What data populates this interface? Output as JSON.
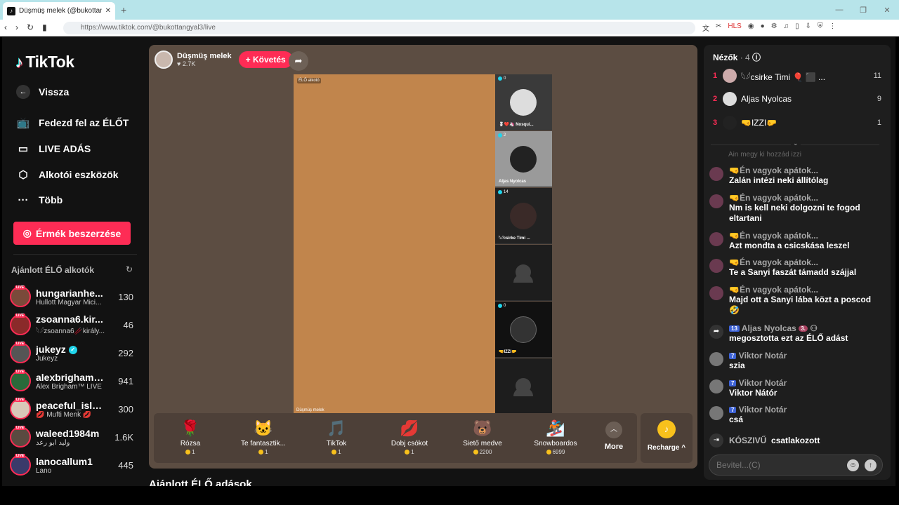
{
  "browser": {
    "tab_title": "Düşmüş melek (@bukottangy...",
    "tab_close": "✕",
    "new_tab": "+",
    "url": "https://www.tiktok.com/@bukottangyal3/live"
  },
  "sidebar": {
    "logo": "TikTok",
    "back": "Vissza",
    "items": [
      {
        "label": "Fedezd fel az ÉLŐT",
        "icon": "tv-icon"
      },
      {
        "label": "LIVE ADÁS",
        "icon": "camera-icon"
      },
      {
        "label": "Alkotói eszközök",
        "icon": "creator-tools-icon"
      },
      {
        "label": "Több",
        "icon": "more-dots-icon"
      }
    ],
    "coins_button": "Érmék beszerzése",
    "suggested_title": "Ajánlott ÉLŐ alkotók",
    "creators": [
      {
        "name": "hungarianhe...",
        "sub": "Hullott Magyar Mici...",
        "count": "130"
      },
      {
        "name": "zsoanna6.kir...",
        "sub": "𓆩𓆪zsoanna6🥢király...",
        "count": "46"
      },
      {
        "name": "jukeyz",
        "sub": "Jukeyz",
        "count": "292",
        "verified": true
      },
      {
        "name": "alexbrighaml...",
        "sub": "Alex Brigham™ LIVE",
        "count": "941"
      },
      {
        "name": "peaceful_isla...",
        "sub": "💋 Mufti Menk 💋",
        "count": "300"
      },
      {
        "name": "waleed1984m",
        "sub": "وليد ابو رعد",
        "count": "1.6K"
      },
      {
        "name": "lanocallum1",
        "sub": "Lano",
        "count": "445"
      }
    ],
    "live_badge": "LIVE"
  },
  "stream": {
    "host_name": "Düşmüş melek",
    "host_likes": "♥ 2.7K",
    "follow": "+ Követés",
    "video_tag": "ÉLŐ alkotó",
    "video_name": "Düşmüş melek",
    "guests": [
      {
        "count": "0",
        "name": "🎖❤️🦄 Nosqui..."
      },
      {
        "count": "2",
        "name": "Aljas Nyolcas"
      },
      {
        "count": "14",
        "name": "𓆩𓆪csirke Timi ..."
      },
      {
        "count": "",
        "name": ""
      },
      {
        "count": "0",
        "name": "🤜IZZI🤛"
      },
      {
        "count": "",
        "name": ""
      }
    ],
    "gifts": [
      {
        "name": "Rózsa",
        "price": "1",
        "icon": "🌹"
      },
      {
        "name": "Te fantasztik...",
        "price": "1",
        "icon": "🐱"
      },
      {
        "name": "TikTok",
        "price": "1",
        "icon": "🎵"
      },
      {
        "name": "Dobj csókot",
        "price": "1",
        "icon": "💋"
      },
      {
        "name": "Siető medve",
        "price": "2200",
        "icon": "🐻"
      },
      {
        "name": "Snowboardos",
        "price": "6999",
        "icon": "🏂"
      }
    ],
    "more": "More",
    "recharge": "Recharge ^",
    "recommended_title": "Ajánlott ÉLŐ adások"
  },
  "viewers": {
    "title": "Nézők",
    "count": "· 4",
    "list": [
      {
        "rank": "1",
        "name": "𓆩𓆪csirke Timi 🎈 ⬛ ...",
        "score": "11"
      },
      {
        "rank": "2",
        "name": "Aljas Nyolcas",
        "score": "9"
      },
      {
        "rank": "3",
        "name": "🤜IZZI🤛",
        "score": "1"
      }
    ]
  },
  "chat": {
    "faded": "Ain megy ki hozzád izzi",
    "messages": [
      {
        "name": "🤜Én vagyok apátok...",
        "text": "Zalán intézi neki állítólag"
      },
      {
        "name": "🤜Én vagyok apátok...",
        "text": "Nm is kell neki dolgozni te fogod eltartani"
      },
      {
        "name": "🤜Én vagyok apátok...",
        "text": "Azt mondta a csicskása leszel"
      },
      {
        "name": "🤜Én vagyok apátok...",
        "text": "Te a Sanyi faszát támadd szájjal"
      },
      {
        "name": "🤜Én vagyok apátok...",
        "text": "Majd ott a Sanyi lába közt a poscod 🤣"
      }
    ],
    "share": {
      "badge": "13",
      "name": "Aljas Nyolcas",
      "badge2": "3.",
      "text": "megosztotta ezt az ÉLŐ adást"
    },
    "viktor": [
      {
        "badge": "7",
        "name": "Viktor Notár",
        "text": "szia"
      },
      {
        "badge": "7",
        "name": "Viktor Notár",
        "text": "Viktor Nátór"
      },
      {
        "badge": "7",
        "name": "Viktor Notár",
        "text": "csá"
      }
    ],
    "join": {
      "name": "KÓSZIVŰ",
      "text": "csatlakozott"
    },
    "input_placeholder": "Bevitel...(C)"
  }
}
